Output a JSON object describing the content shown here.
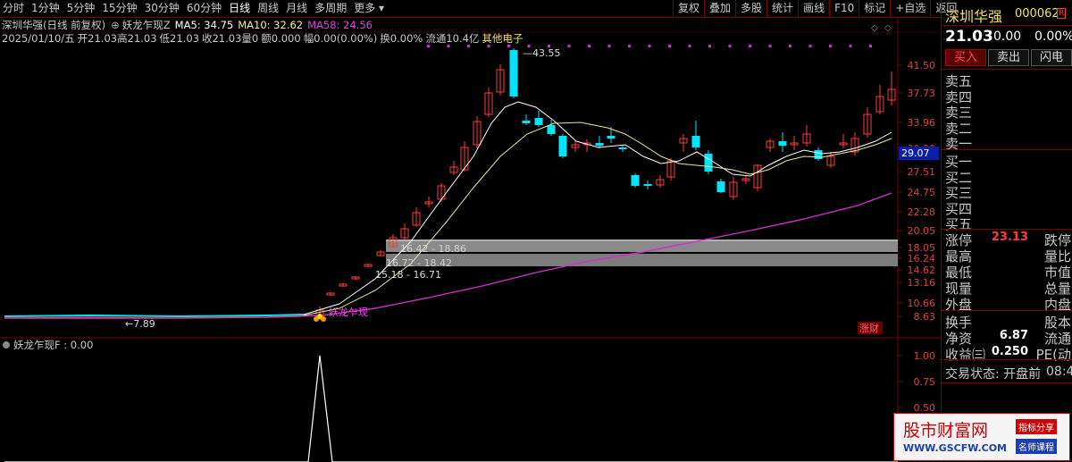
{
  "toolbar": {
    "periods": [
      "分时",
      "1分钟",
      "5分钟",
      "15分钟",
      "30分钟",
      "60分钟",
      "日线",
      "周线",
      "月线",
      "多周期",
      "更多"
    ],
    "active": "日线",
    "right_buttons": [
      "复权",
      "叠加",
      "多股",
      "统计",
      "画线",
      "F10",
      "标记",
      "+自选",
      "返回"
    ]
  },
  "header": {
    "stock": "深圳华强(日线 前复权)",
    "indicator": "妖龙乍现Z",
    "ma5": "MA5: 34.75",
    "ma10": "MA10: 32.62",
    "ma58": "MA58: 24.56",
    "date": "2025/01/10/五",
    "open": "开21.03",
    "high": "高21.03",
    "low": "低21.03",
    "close": "收21.03",
    "vol": "量0",
    "amount": "额0.000",
    "amp": "幅0.00(0.00%)",
    "turnover": "换0.00%",
    "float": "流通10.4亿",
    "sector": "其他电子"
  },
  "main_chart": {
    "price_axis": [
      "41.50",
      "37.73",
      "33.96",
      "30.20",
      "27.51",
      "24.75",
      "22.28",
      "20.05",
      "18.05",
      "16.24",
      "14.62",
      "13.16",
      "10.66",
      "8.63"
    ],
    "current_price_tag": "29.07",
    "annotations": {
      "high": "43.55",
      "low": "7.89",
      "band1": "16.42 - 18.86",
      "band2": "16.72 - 18.42",
      "band3": "15.18 - 16.71",
      "signal": "妖龙乍现",
      "zhangcai": "涨财"
    }
  },
  "sub_chart": {
    "title": "妖龙乍现F : 0.00",
    "axis": [
      "1.00",
      "0.75",
      "0.50"
    ]
  },
  "quote": {
    "name": "深圳华强",
    "code": "000062",
    "badge": "R",
    "price": "21.03",
    "change": "0.00",
    "pct": "0.00%",
    "buy": "买入",
    "sell": "卖出",
    "more": "闪电",
    "order_book": [
      "卖五",
      "卖四",
      "卖三",
      "卖二",
      "卖一",
      "买一",
      "买二",
      "买三",
      "买四",
      "买五"
    ],
    "stats": [
      {
        "l": "涨停",
        "v": "23.13",
        "r": "跌停"
      },
      {
        "l": "最高",
        "v": "",
        "r": "量比"
      },
      {
        "l": "最低",
        "v": "",
        "r": "市值"
      },
      {
        "l": "现量",
        "v": "",
        "r": "总量"
      },
      {
        "l": "外盘",
        "v": "",
        "r": "内盘"
      },
      {
        "l": "换手",
        "v": "",
        "r": "股本"
      },
      {
        "l": "净资",
        "v": "6.87",
        "r": "流通"
      },
      {
        "l": "收益㈢",
        "v": "0.250",
        "r": "PE(动"
      }
    ],
    "trade_status": "交易状态: 开盘前",
    "time": "08:4"
  },
  "ad": {
    "title": "股市财富网",
    "url": "WWW.GSCFW.COM",
    "tag1": "指标分享",
    "tag2": "名师课程"
  },
  "colors": {
    "up": "#ff3b3b",
    "down": "#00e4ff",
    "ma5": "#ffffff",
    "ma10": "#e8e8a0",
    "ma58": "#d030d0",
    "frame": "#7a0000"
  }
}
